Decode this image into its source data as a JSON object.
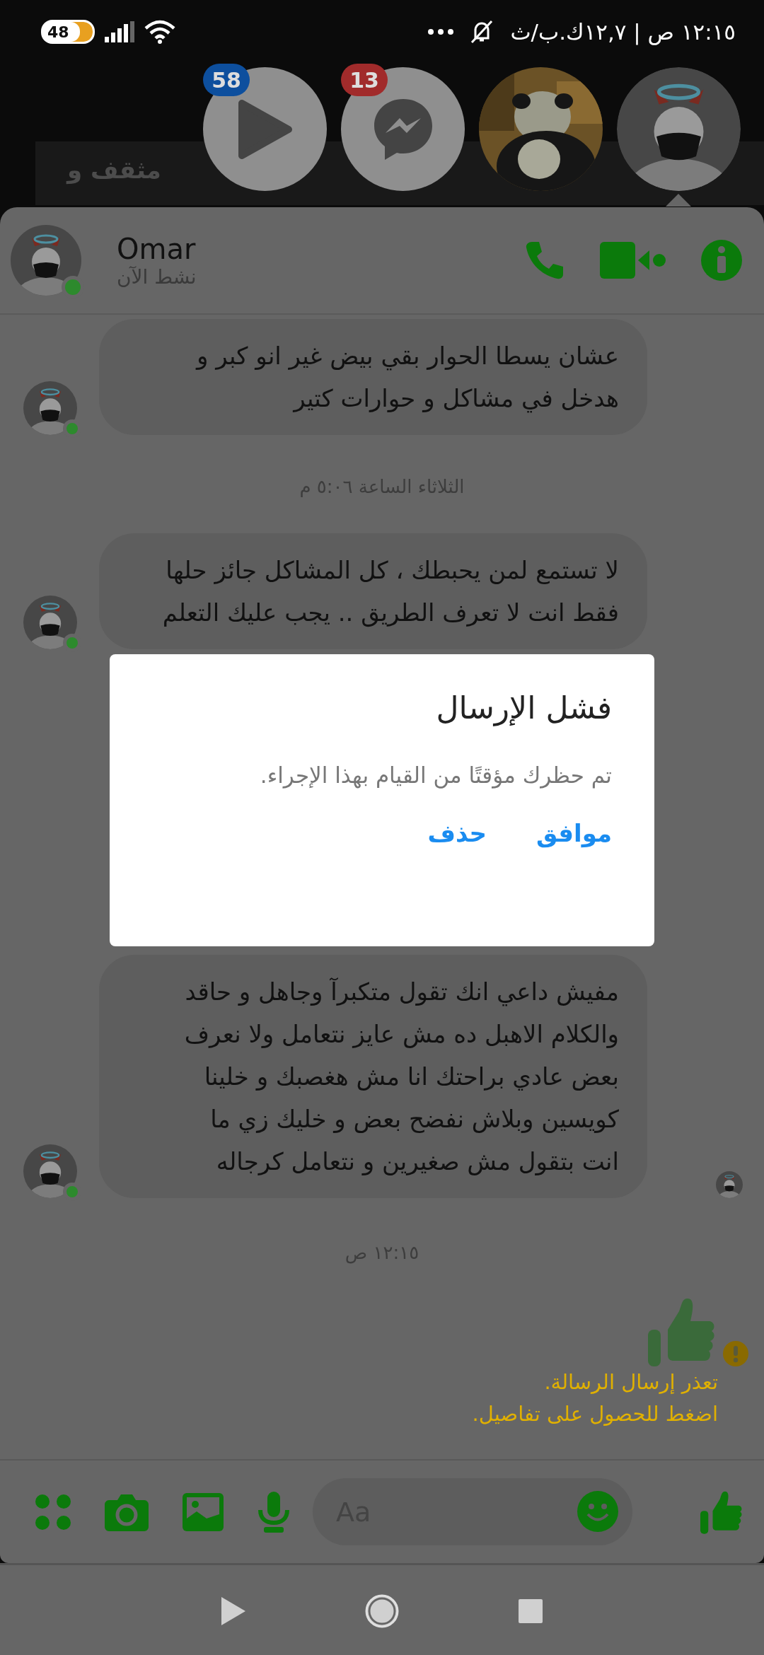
{
  "status_bar": {
    "battery": "48",
    "time": "١٢:١٥ ص | ١٢,٧ك.ب/ث"
  },
  "background_text": "مثقف و",
  "chat_heads": [
    {
      "kind": "avatar",
      "selected": true
    },
    {
      "kind": "picture",
      "selected": false
    },
    {
      "kind": "messenger",
      "badge": "13",
      "color": "#a12b2b",
      "selected": false
    },
    {
      "kind": "video",
      "badge": "58",
      "color": "#0d4f9e",
      "selected": false
    }
  ],
  "header": {
    "name": "Omar",
    "status": "نشط الآن",
    "online": true
  },
  "messages": [
    {
      "kind": "received",
      "online": true,
      "seen": false,
      "lines": [
        "عشان يسطا الحوار بقي بيض غير انو كبر و",
        "هدخل في مشاكل و حوارات كتير"
      ]
    },
    {
      "kind": "timestamp",
      "text": "الثلاثاء الساعة ٥:٠٦ م"
    },
    {
      "kind": "received",
      "online": true,
      "seen": false,
      "lines": [
        "لا تستمع لمن يحبطك ، كل المشاكل جائز حلها",
        "فقط انت لا تعرف الطريق .. يجب عليك التعلم"
      ]
    },
    {
      "kind": "received",
      "online": true,
      "seen": true,
      "lines": [
        "مفيش داعي انك تقول متكبرآ وجاهل و حاقد",
        "والكلام الاهبل ده مش عايز نتعامل ولا نعرف",
        "بعض عادي براحتك انا مش هغصبك و خلينا",
        "كويسين وبلاش نفضح بعض و خليك زي ما",
        "انت بتقول مش صغيرين و نتعامل كرجاله"
      ]
    },
    {
      "kind": "timestamp",
      "text": "١٢:١٥ ص"
    },
    {
      "kind": "like",
      "failed": true,
      "error_lines": [
        "تعذر إرسال الرسالة.",
        "اضغط للحصول على تفاصيل."
      ]
    }
  ],
  "composer": {
    "placeholder": "Aa"
  },
  "dialog": {
    "title": "فشل الإرسال",
    "message": "تم حظرك مؤقتًا من القيام بهذا الإجراء.",
    "buttons": [
      "موافق",
      "حذف"
    ]
  }
}
